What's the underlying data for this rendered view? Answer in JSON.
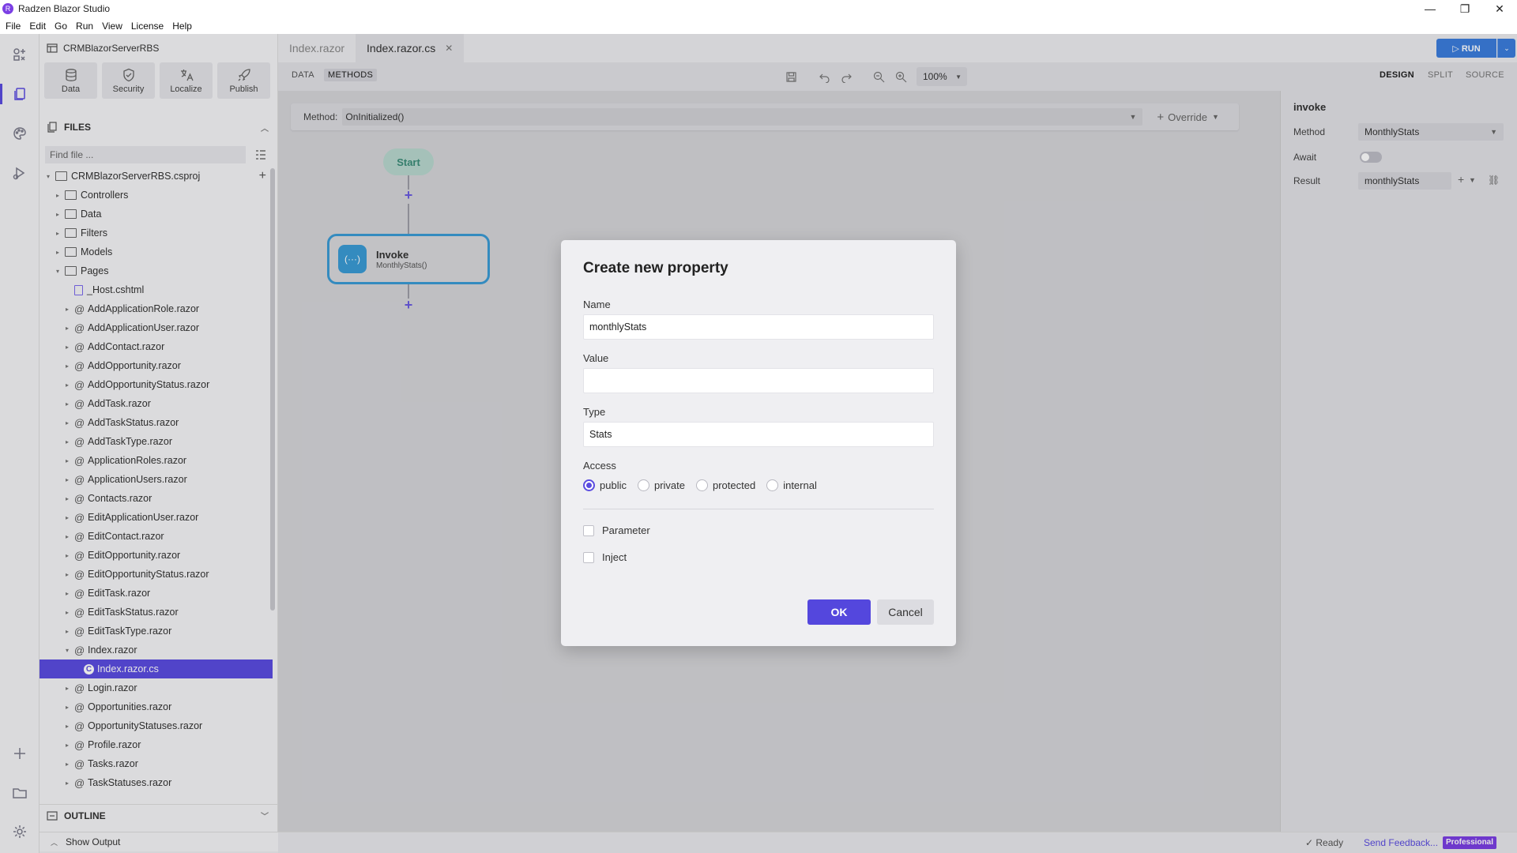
{
  "app": {
    "title": "Radzen Blazor Studio",
    "logo_letter": "R"
  },
  "menu": [
    "File",
    "Edit",
    "Go",
    "Run",
    "View",
    "License",
    "Help"
  ],
  "window_controls": {
    "minimize": "—",
    "restore": "❐",
    "close": "✕"
  },
  "sidebar": {
    "project": "CRMBlazorServerRBS",
    "tools": [
      {
        "label": "Data",
        "icon": "database-icon"
      },
      {
        "label": "Security",
        "icon": "shield-icon"
      },
      {
        "label": "Localize",
        "icon": "translate-icon"
      },
      {
        "label": "Publish",
        "icon": "rocket-icon"
      }
    ],
    "files_header": "FILES",
    "search_placeholder": "Find file ...",
    "tree": [
      {
        "label": "CRMBlazorServerRBS.csproj",
        "indent": 0,
        "kind": "folder",
        "caret": "▾"
      },
      {
        "label": "Controllers",
        "indent": 1,
        "kind": "folder",
        "caret": "▸"
      },
      {
        "label": "Data",
        "indent": 1,
        "kind": "folder",
        "caret": "▸"
      },
      {
        "label": "Filters",
        "indent": 1,
        "kind": "folder",
        "caret": "▸"
      },
      {
        "label": "Models",
        "indent": 1,
        "kind": "folder",
        "caret": "▸"
      },
      {
        "label": "Pages",
        "indent": 1,
        "kind": "folder",
        "caret": "▾"
      },
      {
        "label": "_Host.cshtml",
        "indent": 2,
        "kind": "file",
        "caret": ""
      },
      {
        "label": "AddApplicationRole.razor",
        "indent": 2,
        "kind": "razor",
        "caret": "▸"
      },
      {
        "label": "AddApplicationUser.razor",
        "indent": 2,
        "kind": "razor",
        "caret": "▸"
      },
      {
        "label": "AddContact.razor",
        "indent": 2,
        "kind": "razor",
        "caret": "▸"
      },
      {
        "label": "AddOpportunity.razor",
        "indent": 2,
        "kind": "razor",
        "caret": "▸"
      },
      {
        "label": "AddOpportunityStatus.razor",
        "indent": 2,
        "kind": "razor",
        "caret": "▸"
      },
      {
        "label": "AddTask.razor",
        "indent": 2,
        "kind": "razor",
        "caret": "▸"
      },
      {
        "label": "AddTaskStatus.razor",
        "indent": 2,
        "kind": "razor",
        "caret": "▸"
      },
      {
        "label": "AddTaskType.razor",
        "indent": 2,
        "kind": "razor",
        "caret": "▸"
      },
      {
        "label": "ApplicationRoles.razor",
        "indent": 2,
        "kind": "razor",
        "caret": "▸"
      },
      {
        "label": "ApplicationUsers.razor",
        "indent": 2,
        "kind": "razor",
        "caret": "▸"
      },
      {
        "label": "Contacts.razor",
        "indent": 2,
        "kind": "razor",
        "caret": "▸"
      },
      {
        "label": "EditApplicationUser.razor",
        "indent": 2,
        "kind": "razor",
        "caret": "▸"
      },
      {
        "label": "EditContact.razor",
        "indent": 2,
        "kind": "razor",
        "caret": "▸"
      },
      {
        "label": "EditOpportunity.razor",
        "indent": 2,
        "kind": "razor",
        "caret": "▸"
      },
      {
        "label": "EditOpportunityStatus.razor",
        "indent": 2,
        "kind": "razor",
        "caret": "▸"
      },
      {
        "label": "EditTask.razor",
        "indent": 2,
        "kind": "razor",
        "caret": "▸"
      },
      {
        "label": "EditTaskStatus.razor",
        "indent": 2,
        "kind": "razor",
        "caret": "▸"
      },
      {
        "label": "EditTaskType.razor",
        "indent": 2,
        "kind": "razor",
        "caret": "▸"
      },
      {
        "label": "Index.razor",
        "indent": 2,
        "kind": "razor",
        "caret": "▾"
      },
      {
        "label": "Index.razor.cs",
        "indent": 3,
        "kind": "cs",
        "caret": "",
        "selected": true
      },
      {
        "label": "Login.razor",
        "indent": 2,
        "kind": "razor",
        "caret": "▸"
      },
      {
        "label": "Opportunities.razor",
        "indent": 2,
        "kind": "razor",
        "caret": "▸"
      },
      {
        "label": "OpportunityStatuses.razor",
        "indent": 2,
        "kind": "razor",
        "caret": "▸"
      },
      {
        "label": "Profile.razor",
        "indent": 2,
        "kind": "razor",
        "caret": "▸"
      },
      {
        "label": "Tasks.razor",
        "indent": 2,
        "kind": "razor",
        "caret": "▸"
      },
      {
        "label": "TaskStatuses.razor",
        "indent": 2,
        "kind": "razor",
        "caret": "▸"
      }
    ],
    "outline_header": "OUTLINE",
    "show_output": "Show Output"
  },
  "tabs": [
    {
      "label": "Index.razor",
      "active": false
    },
    {
      "label": "Index.razor.cs",
      "active": true
    }
  ],
  "run": {
    "label": "▷ RUN",
    "dropdown": "⌄"
  },
  "toolbar": {
    "data_tab": "DATA",
    "methods_tab": "METHODS",
    "zoom": "100%",
    "design": "DESIGN",
    "split": "SPLIT",
    "source": "SOURCE"
  },
  "canvas": {
    "method_label": "Method:",
    "method_value": "OnInitialized()",
    "override_label": "Override",
    "start": "Start",
    "invoke_title": "Invoke",
    "invoke_sub": "MonthlyStats()",
    "invoke_glyph": "(···)"
  },
  "properties": {
    "title": "invoke",
    "method_label": "Method",
    "method_value": "MonthlyStats",
    "await_label": "Await",
    "await_on": false,
    "result_label": "Result",
    "result_value": "monthlyStats"
  },
  "status": {
    "ready": "✓ Ready",
    "feedback": "Send Feedback...",
    "badge": "Professional"
  },
  "dialog": {
    "title": "Create new property",
    "name_label": "Name",
    "name_value": "monthlyStats",
    "value_label": "Value",
    "value_value": "",
    "type_label": "Type",
    "type_value": "Stats",
    "access_label": "Access",
    "access_options": [
      "public",
      "private",
      "protected",
      "internal"
    ],
    "access_selected": "public",
    "parameter_label": "Parameter",
    "inject_label": "Inject",
    "ok": "OK",
    "cancel": "Cancel"
  },
  "colors": {
    "accent": "#5b4ce0",
    "run": "#3b7ddd",
    "node_border": "#3a9bd5",
    "start_node": "#b8d7cf"
  }
}
